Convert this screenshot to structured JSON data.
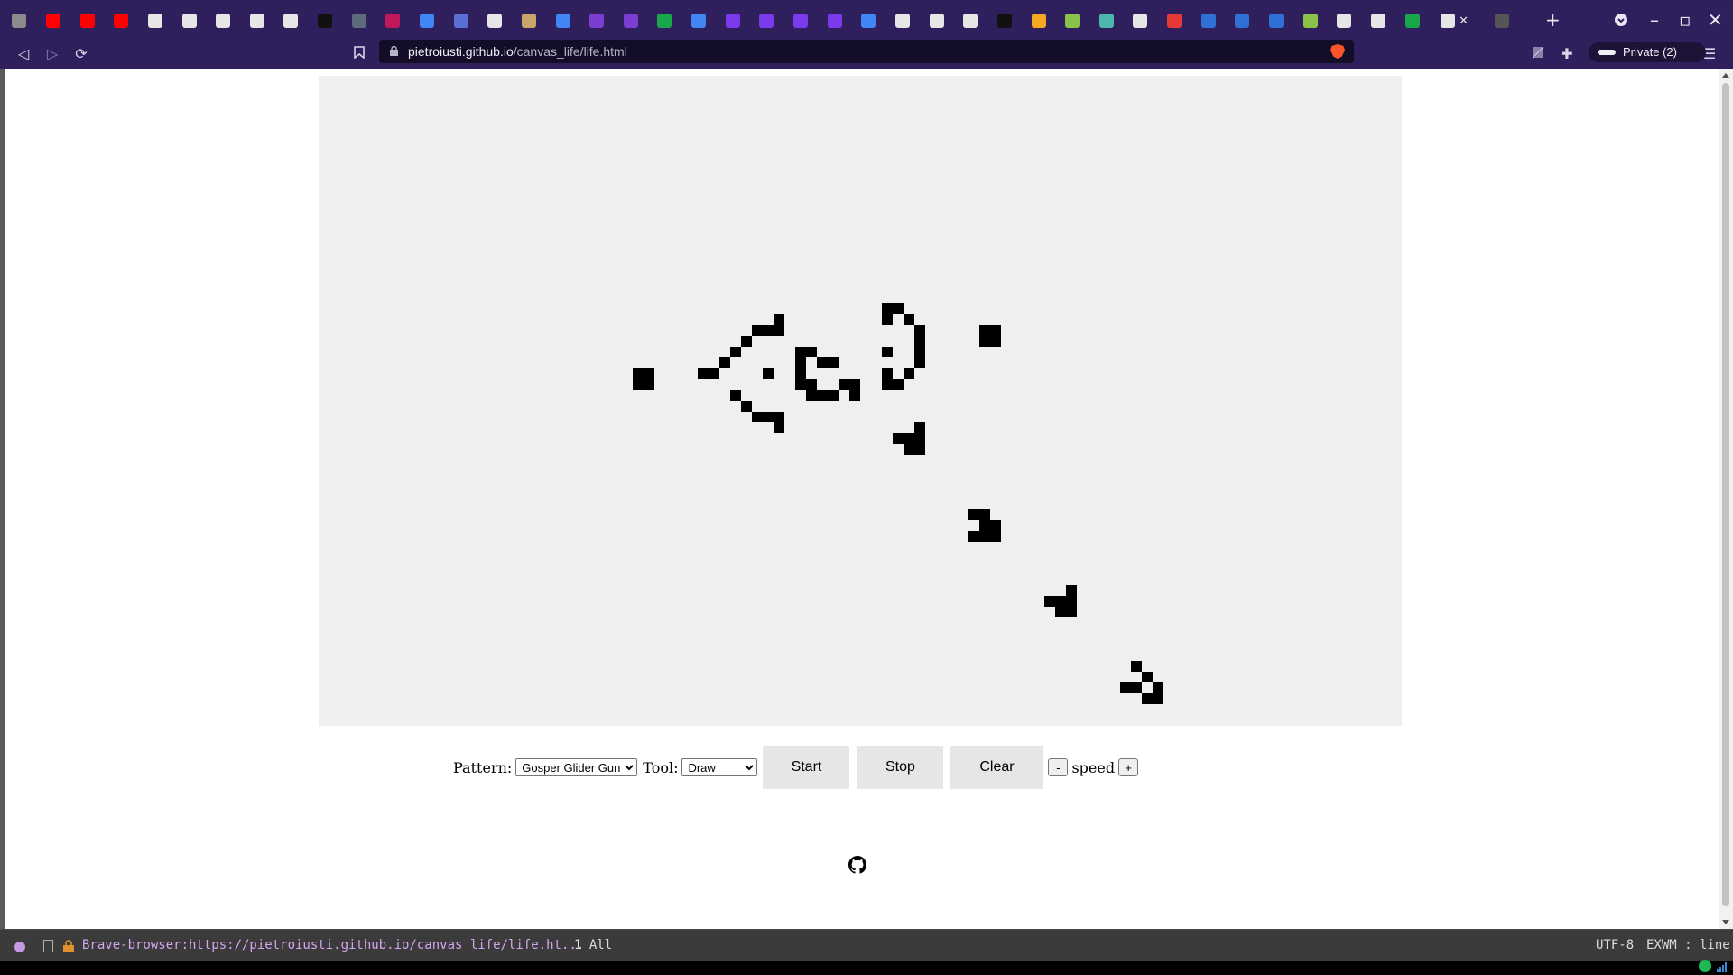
{
  "browser": {
    "address": {
      "host": "pietroiusti.github.io",
      "path": "/canvas_life/life.html"
    },
    "private_label": "Private (2)",
    "tab_favicons": [
      "#8b8b8b",
      "#ff0000",
      "#ff0000",
      "#ff0000",
      "#e6e6e6",
      "#e6e6e6",
      "#e6e6e6",
      "#e6e6e6",
      "#e6e6e6",
      "#111111",
      "#5f6b7a",
      "#c2185b",
      "#4285f4",
      "#5b6fd6",
      "#e6e6e6",
      "#c9a56a",
      "#4285f4",
      "#7a3fd1",
      "#7a3fd1",
      "#18a84a",
      "#4285f4",
      "#7c3aed",
      "#7c3aed",
      "#7c3aed",
      "#7c3aed",
      "#4285f4",
      "#e6e6e6",
      "#e6e6e6",
      "#e6e6e6",
      "#111111",
      "#f5a623",
      "#8bc34a",
      "#4db6ac",
      "#e6e6e6",
      "#e53935",
      "#2f6fd6",
      "#2f6fd6",
      "#2f6fd6",
      "#8bc34a",
      "#e6e6e6",
      "#e6e6e6",
      "#18a84a",
      "#e6e6e6",
      "#555555"
    ]
  },
  "page": {
    "board": {
      "background": "#efefef",
      "cell_color": "#000000",
      "live_cells": [
        [
          29,
          27
        ],
        [
          30,
          27
        ],
        [
          29,
          28
        ],
        [
          30,
          28
        ],
        [
          35,
          27
        ],
        [
          36,
          27
        ],
        [
          37,
          26
        ],
        [
          38,
          25
        ],
        [
          38,
          29
        ],
        [
          39,
          24
        ],
        [
          39,
          30
        ],
        [
          40,
          23
        ],
        [
          40,
          31
        ],
        [
          41,
          23
        ],
        [
          41,
          27
        ],
        [
          41,
          31
        ],
        [
          42,
          22
        ],
        [
          42,
          23
        ],
        [
          42,
          31
        ],
        [
          42,
          32
        ],
        [
          44,
          25
        ],
        [
          44,
          26
        ],
        [
          44,
          27
        ],
        [
          44,
          28
        ],
        [
          45,
          25
        ],
        [
          45,
          28
        ],
        [
          45,
          29
        ],
        [
          46,
          26
        ],
        [
          46,
          29
        ],
        [
          47,
          26
        ],
        [
          47,
          29
        ],
        [
          48,
          28
        ],
        [
          49,
          28
        ],
        [
          49,
          29
        ],
        [
          52,
          21
        ],
        [
          52,
          22
        ],
        [
          52,
          25
        ],
        [
          52,
          27
        ],
        [
          52,
          28
        ],
        [
          53,
          21
        ],
        [
          53,
          28
        ],
        [
          54,
          22
        ],
        [
          54,
          27
        ],
        [
          55,
          23
        ],
        [
          55,
          24
        ],
        [
          55,
          25
        ],
        [
          55,
          26
        ],
        [
          53,
          33
        ],
        [
          54,
          33
        ],
        [
          54,
          34
        ],
        [
          55,
          32
        ],
        [
          55,
          33
        ],
        [
          55,
          34
        ],
        [
          61,
          23
        ],
        [
          62,
          23
        ],
        [
          61,
          24
        ],
        [
          62,
          24
        ],
        [
          60,
          40
        ],
        [
          61,
          40
        ],
        [
          61,
          41
        ],
        [
          62,
          41
        ],
        [
          62,
          42
        ],
        [
          61,
          42
        ],
        [
          60,
          42
        ],
        [
          67,
          48
        ],
        [
          68,
          48
        ],
        [
          68,
          49
        ],
        [
          69,
          47
        ],
        [
          69,
          48
        ],
        [
          69,
          49
        ],
        [
          75,
          54
        ],
        [
          76,
          55
        ],
        [
          75,
          56
        ],
        [
          74,
          56
        ],
        [
          76,
          57
        ],
        [
          77,
          56
        ],
        [
          77,
          57
        ]
      ]
    },
    "controls": {
      "pattern_label": "Pattern:",
      "pattern_selected": "Gosper Glider Gun",
      "tool_label": "Tool:",
      "tool_selected": "Draw",
      "start_label": "Start",
      "stop_label": "Stop",
      "clear_label": "Clear",
      "speed_minus": "-",
      "speed_label": "speed",
      "speed_plus": "+"
    }
  },
  "statusbar": {
    "buffer": "Brave-browser:https://pietroiusti.github.io/canvas_life/life.ht...",
    "position": "1 All",
    "encoding": "UTF-8",
    "mode": "EXWM : line"
  }
}
